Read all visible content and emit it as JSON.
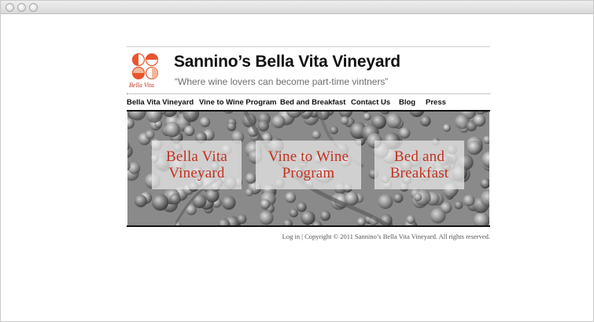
{
  "site": {
    "title": "Sannino’s Bella Vita Vineyard",
    "tagline": "“Where wine lovers can become part-time vintners”",
    "logo_script": "Bella Vita"
  },
  "nav": {
    "items": [
      {
        "label": "Bella Vita Vineyard"
      },
      {
        "label": "Vine to Wine Program"
      },
      {
        "label": "Bed and Breakfast"
      },
      {
        "label": "Contact Us"
      },
      {
        "label": "Blog"
      },
      {
        "label": "Press"
      }
    ]
  },
  "hero": {
    "cards": [
      {
        "line1": "Bella Vita",
        "line2": "Vineyard"
      },
      {
        "line1": "Vine to Wine",
        "line2": "Program"
      },
      {
        "line1": "Bed and",
        "line2": "Breakfast"
      }
    ]
  },
  "footer": {
    "login": "Log in",
    "separator": "|",
    "copyright": "Copyright © 2011 Sannino’s Bella Vita Vineyard. All rights reserved."
  },
  "colors": {
    "accent_red": "#c4311f",
    "logo_orange": "#e8542e",
    "logo_peach": "#f4b89a"
  }
}
